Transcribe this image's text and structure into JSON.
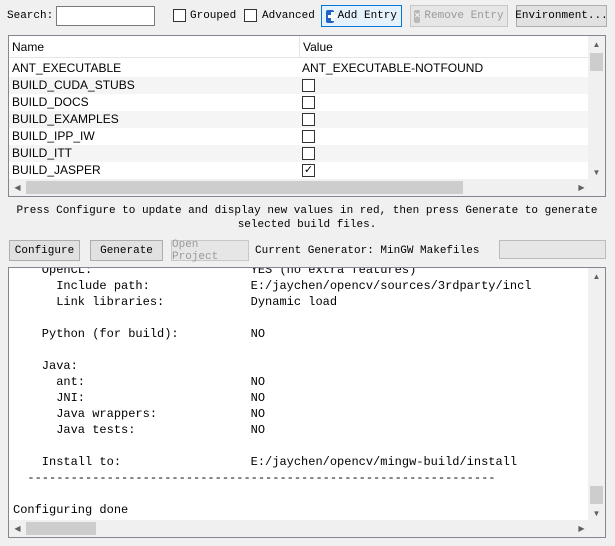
{
  "toolbar": {
    "search_label": "Search:",
    "search_value": "",
    "grouped_label": "Grouped",
    "grouped_checked": false,
    "advanced_label": "Advanced",
    "advanced_checked": false,
    "add_entry_label": "Add Entry",
    "remove_entry_label": "Remove Entry",
    "environment_label": "Environment..."
  },
  "cache_table": {
    "columns": [
      "Name",
      "Value"
    ],
    "rows": [
      {
        "name": "ANT_EXECUTABLE",
        "value": "ANT_EXECUTABLE-NOTFOUND"
      },
      {
        "name": "BUILD_CUDA_STUBS",
        "checked": false
      },
      {
        "name": "BUILD_DOCS",
        "checked": false
      },
      {
        "name": "BUILD_EXAMPLES",
        "checked": false
      },
      {
        "name": "BUILD_IPP_IW",
        "checked": false
      },
      {
        "name": "BUILD_ITT",
        "checked": false
      },
      {
        "name": "BUILD_JASPER",
        "checked": true
      }
    ]
  },
  "hint": "Press Configure to update and display new values in red, then press Generate to generate selected build files.",
  "actions": {
    "configure_label": "Configure",
    "generate_label": "Generate",
    "open_project_label": "Open Project",
    "current_generator": "Current Generator: MinGW Makefiles",
    "progress": 0
  },
  "output": {
    "lines": [
      "    OpenCL:                      YES (no extra features)",
      "      Include path:              E:/jaychen/opencv/sources/3rdparty/incl",
      "      Link libraries:            Dynamic load",
      "",
      "    Python (for build):          NO",
      "",
      "    Java:",
      "      ant:                       NO",
      "      JNI:                       NO",
      "      Java wrappers:             NO",
      "      Java tests:                NO",
      "",
      "    Install to:                  E:/jaychen/opencv/mingw-build/install",
      "  -----------------------------------------------------------------",
      "",
      "Configuring done"
    ]
  }
}
